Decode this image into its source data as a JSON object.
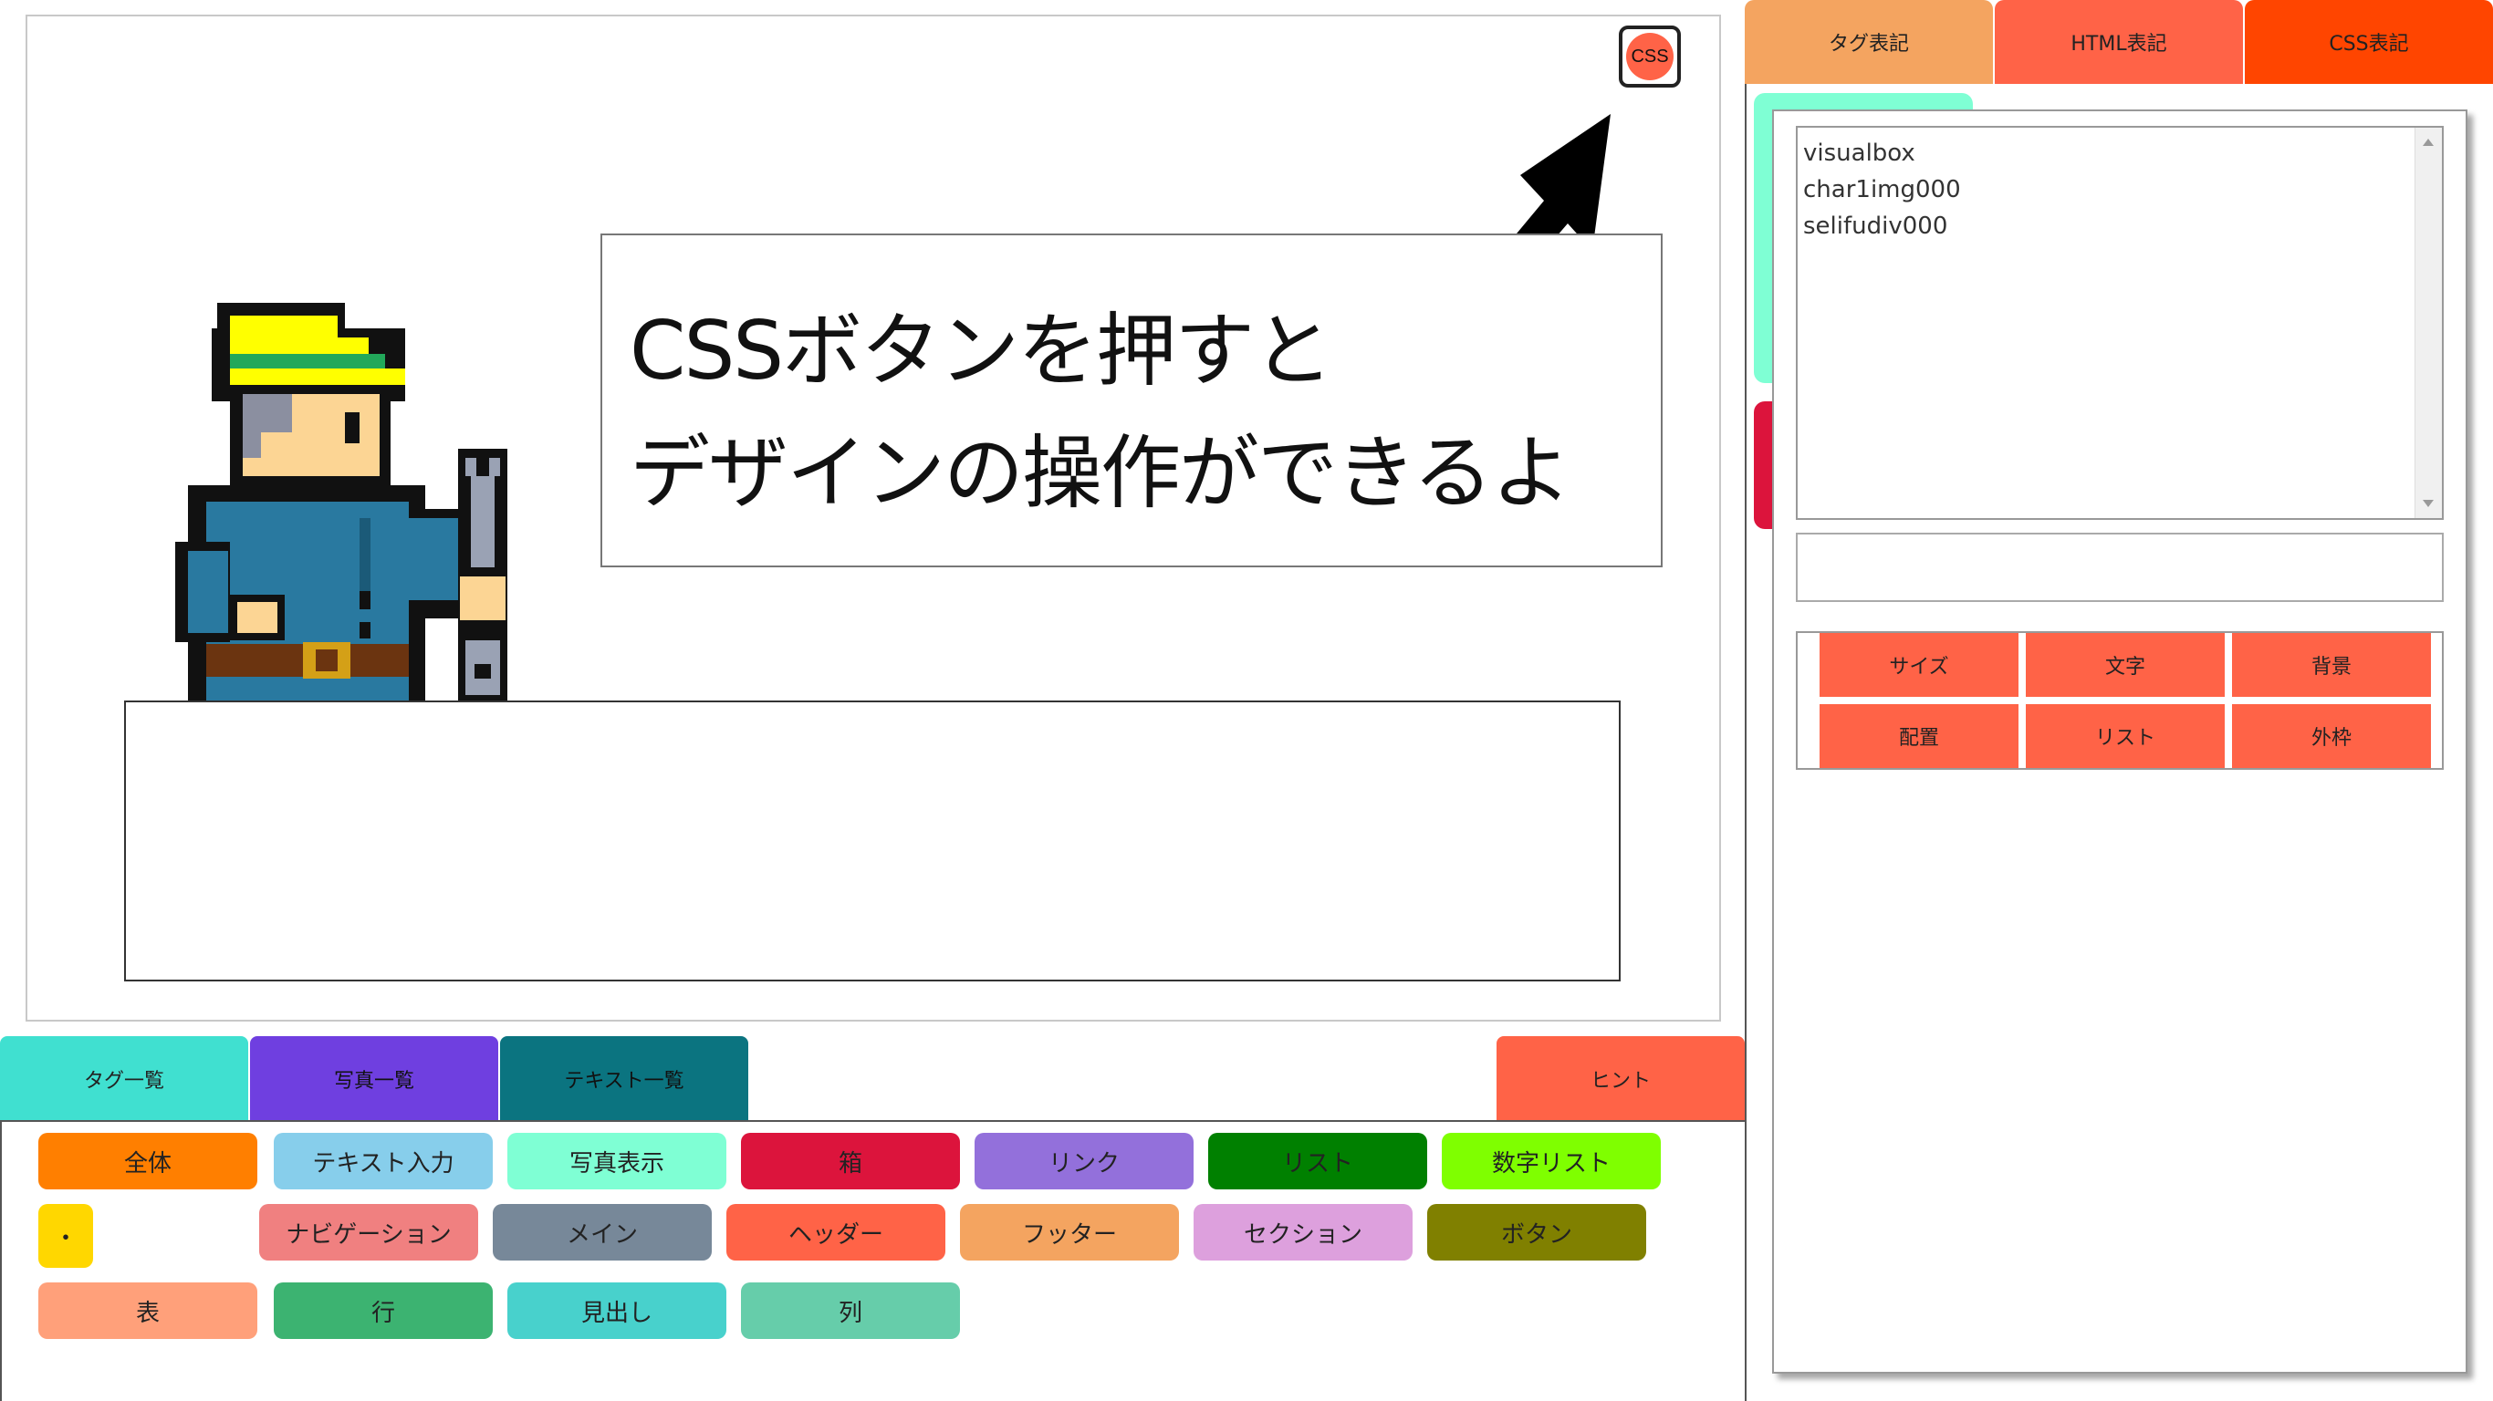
{
  "stage": {
    "css_button_label": "CSS",
    "speech": {
      "line1": "CSSボタンを押すと",
      "line2": "デザインの操作ができるよ"
    }
  },
  "bottom_tabs": {
    "tags": "タグ一覧",
    "photos": "写真一覧",
    "texts": "テキスト一覧",
    "hint": "ヒント"
  },
  "palette": [
    {
      "label": "全体",
      "color": "#ff7f00"
    },
    {
      "label": "テキスト入力",
      "color": "#87ceeb"
    },
    {
      "label": "写真表示",
      "color": "#7fffd4"
    },
    {
      "label": "箱",
      "color": "#dc143c"
    },
    {
      "label": "リンク",
      "color": "#9370db"
    },
    {
      "label": "リスト",
      "color": "#008000"
    },
    {
      "label": "数字リスト",
      "color": "#7fff00"
    },
    {
      "label": "・",
      "color": "#ffd700"
    },
    {
      "label": "ナビゲーション",
      "color": "#f08080"
    },
    {
      "label": "メイン",
      "color": "#778899"
    },
    {
      "label": "ヘッダー",
      "color": "#ff6347"
    },
    {
      "label": "フッター",
      "color": "#f4a460"
    },
    {
      "label": "セクション",
      "color": "#dda0dd"
    },
    {
      "label": "ボタン",
      "color": "#808000"
    },
    {
      "label": "表",
      "color": "#ffa07a"
    },
    {
      "label": "行",
      "color": "#3cb371"
    },
    {
      "label": "見出し",
      "color": "#48d1cc"
    },
    {
      "label": "列",
      "color": "#66cdaa"
    }
  ],
  "right_tabs": {
    "tag": "タグ表記",
    "html": "HTML表記",
    "css": "CSS表記"
  },
  "element_list": [
    "visualbox",
    "char1img000",
    "selifudiv000"
  ],
  "css_buttons": [
    "サイズ",
    "文字",
    "背景",
    "配置",
    "リスト",
    "外枠"
  ]
}
